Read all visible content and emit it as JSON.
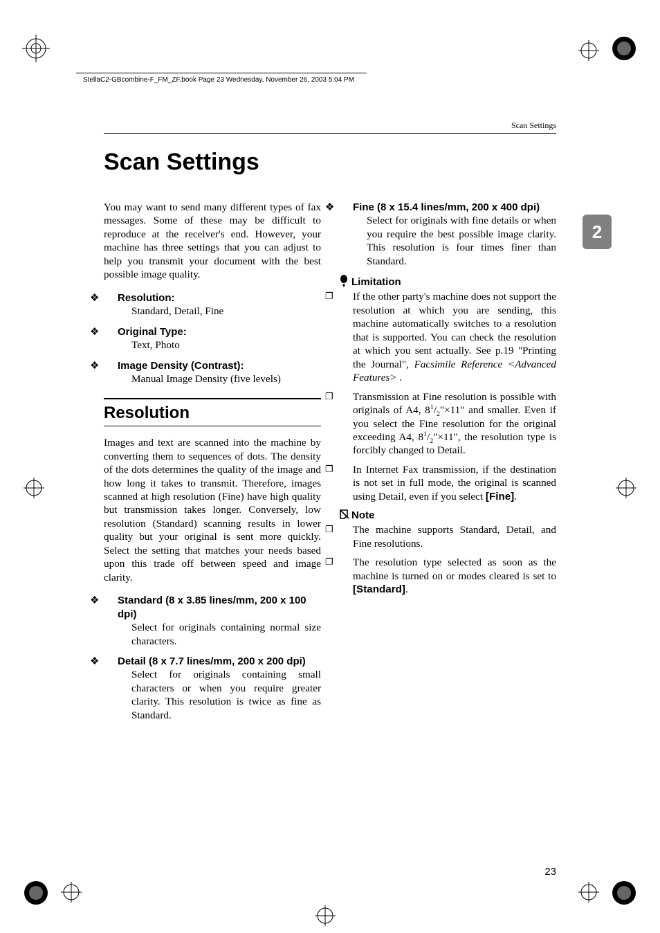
{
  "meta": {
    "header_text": "StellaC2-GBcombine-F_FM_ZF.book  Page 23  Wednesday, November 26, 2003  5:04 PM",
    "running_head": "Scan Settings",
    "chapter_tab": "2",
    "page_number": "23"
  },
  "title": "Scan Settings",
  "intro": "You may want to send many different types of fax messages. Some of these may be difficult to reproduce at the receiver's end. However, your machine has three settings that you can adjust to help you transmit your document with the best possible image quality.",
  "features": {
    "resolution": {
      "label": "Resolution:",
      "text": "Standard, Detail, Fine"
    },
    "originalType": {
      "label": "Original Type:",
      "text": "Text, Photo"
    },
    "imageDensity": {
      "label": "Image Density (Contrast):",
      "text": "Manual Image Density (five levels)"
    }
  },
  "resolution": {
    "heading": "Resolution",
    "intro": "Images and text are scanned into the machine by converting them to sequences of dots. The density of the dots determines the quality of the image and how long it takes to transmit. Therefore, images scanned at high resolution (Fine) have high quality but transmission takes longer. Conversely, low resolution (Standard) scanning results in lower quality but your original is sent more quickly. Select the setting that matches your needs based upon this trade off between speed and image clarity.",
    "modes": {
      "standard": {
        "label": "Standard (8 x 3.85 lines/mm, 200 x 100 dpi)",
        "text": "Select for originals containing normal size characters."
      },
      "detail": {
        "label": "Detail (8 x 7.7 lines/mm, 200 x 200 dpi)",
        "text": "Select for originals containing small characters or when you require greater clarity. This resolution is twice as fine as Standard."
      },
      "fine": {
        "label": "Fine (8 x 15.4 lines/mm, 200 x 400 dpi)",
        "text": "Select for originals with fine details or when you require the best possible image clarity. This resolution is four times finer than Standard."
      }
    },
    "limitation": {
      "heading": "Limitation",
      "item1_a": "If the other party's machine does not support the resolution at which you are sending, this machine automatically switches to a resolution that is supported. You can check the resolution at which you sent actually. See p.19 \"Printing the Journal\", ",
      "item1_b": "Facsimile Reference <Advanced Features>",
      "item1_c": " .",
      "item2_a": "Transmission at Fine resolution is possible with originals of A4, 8",
      "item2_b": "\"×11\" and smaller. Even if you select the Fine resolution for the original exceeding A4, 8",
      "item2_c": "\"×11\", the resolution type is forcibly changed to Detail.",
      "item3_a": "In Internet Fax transmission, if the destination is not set in full mode, the original is scanned using Detail, even if you select ",
      "item3_b": "[Fine]",
      "item3_c": "."
    },
    "note": {
      "heading": "Note",
      "item1": "The machine supports Standard, Detail, and Fine resolutions.",
      "item2_a": "The resolution type selected as soon as the machine is turned on or modes cleared is set to ",
      "item2_b": "[Standard]",
      "item2_c": "."
    }
  }
}
